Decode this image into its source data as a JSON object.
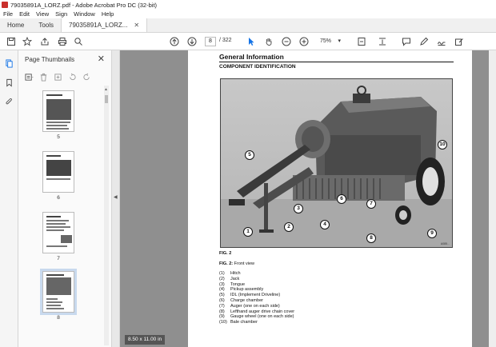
{
  "window": {
    "title": "79035891A_LORZ.pdf - Adobe Acrobat Pro DC (32-bit)"
  },
  "menu": [
    "File",
    "Edit",
    "View",
    "Sign",
    "Window",
    "Help"
  ],
  "tabs": [
    {
      "label": "Home"
    },
    {
      "label": "Tools"
    },
    {
      "label": "79035891A_LORZ..."
    }
  ],
  "toolbar": {
    "current_page": "8",
    "page_count": "/ 322",
    "zoom": "75%"
  },
  "thumbnails": {
    "title": "Page Thumbnails",
    "items": [
      {
        "num": "5"
      },
      {
        "num": "6"
      },
      {
        "num": "7"
      },
      {
        "num": "8"
      }
    ]
  },
  "document": {
    "heading": "General Information",
    "subheading": "COMPONENT IDENTIFICATION",
    "fig_label": "FIG. 2",
    "caption_bold": "FIG. 2:",
    "caption_text": "Front view",
    "figure_code": "A085...",
    "callouts": [
      "1",
      "2",
      "3",
      "4",
      "5",
      "6",
      "7",
      "8",
      "9",
      "10"
    ],
    "legend": [
      {
        "n": "(1)",
        "text": "Hitch"
      },
      {
        "n": "(2)",
        "text": "Jack"
      },
      {
        "n": "(3)",
        "text": "Tongue"
      },
      {
        "n": "(4)",
        "text": "Pickup assembly"
      },
      {
        "n": "(5)",
        "text": "IDL (Implement Driveline)"
      },
      {
        "n": "(6)",
        "text": "Charge chamber"
      },
      {
        "n": "(7)",
        "text": "Auger (one on each side)"
      },
      {
        "n": "(8)",
        "text": "Lefthand auger drive chain cover"
      },
      {
        "n": "(9)",
        "text": "Gauge wheel (one on each side)"
      },
      {
        "n": "(10)",
        "text": "Bale chamber"
      }
    ]
  },
  "status": {
    "page_size": "8.50 x 11.00 in"
  },
  "colors": {
    "accent": "#1473e6",
    "app_icon": "#c9302c"
  }
}
